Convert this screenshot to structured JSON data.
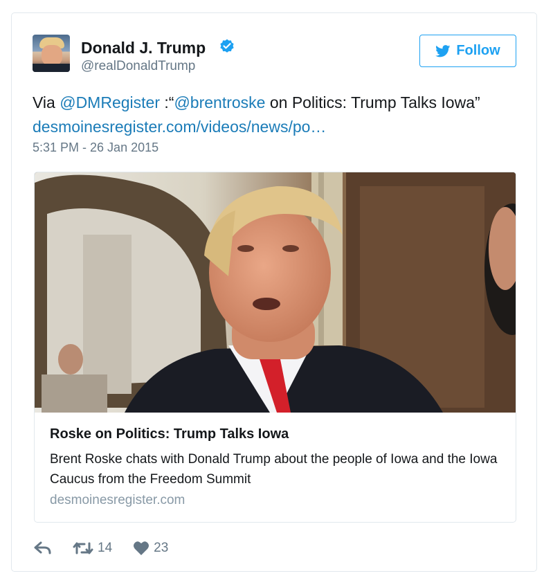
{
  "author": {
    "name": "Donald J. Trump",
    "handle": "@realDonaldTrump",
    "verified": true
  },
  "follow_button": {
    "label": "Follow",
    "icon": "twitter-bird-icon",
    "color": "#1da1f2"
  },
  "tweet": {
    "prefix": "Via ",
    "mention1": "@DMRegister",
    "middle": " :“",
    "mention2": "@brentroske",
    "suffix": " on Politics: Trump Talks Iowa”",
    "link": "desmoinesregister.com/videos/news/po…",
    "timestamp": "5:31 PM - 26 Jan 2015"
  },
  "card": {
    "title": "Roske on Politics: Trump Talks Iowa",
    "description": "Brent Roske chats with Donald Trump about the people of Iowa and the Iowa Caucus from the Freedom Summit",
    "domain": "desmoinesregister.com"
  },
  "actions": {
    "reply_icon": "reply-icon",
    "retweet_icon": "retweet-icon",
    "retweet_count": "14",
    "like_icon": "heart-icon",
    "like_count": "23"
  },
  "colors": {
    "link": "#1b7cb8",
    "muted": "#657786",
    "border": "#e1e8ed"
  }
}
